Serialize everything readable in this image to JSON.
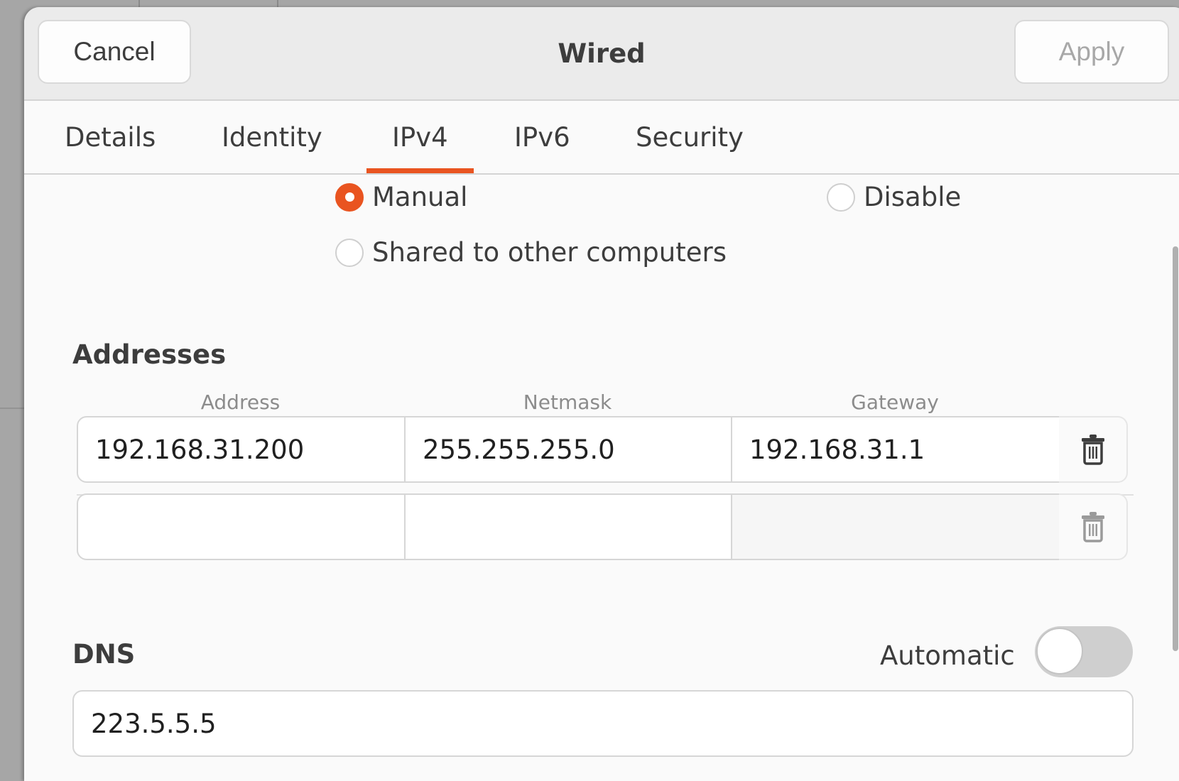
{
  "dialog": {
    "title": "Wired",
    "cancel_label": "Cancel",
    "apply_label": "Apply",
    "apply_enabled": false
  },
  "tabs": [
    {
      "label": "Details",
      "active": false
    },
    {
      "label": "Identity",
      "active": false
    },
    {
      "label": "IPv4",
      "active": true
    },
    {
      "label": "IPv6",
      "active": false
    },
    {
      "label": "Security",
      "active": false
    }
  ],
  "ipv4_method": {
    "options": [
      {
        "label": "Manual",
        "checked": true
      },
      {
        "label": "Disable",
        "checked": false
      },
      {
        "label": "Shared to other computers",
        "checked": false
      }
    ]
  },
  "addresses": {
    "title": "Addresses",
    "columns": [
      "Address",
      "Netmask",
      "Gateway"
    ],
    "rows": [
      {
        "address": "192.168.31.200",
        "netmask": "255.255.255.0",
        "gateway": "192.168.31.1",
        "delete_icon": "trash-icon"
      },
      {
        "address": "",
        "netmask": "",
        "gateway": "",
        "delete_icon": "trash-icon"
      }
    ]
  },
  "dns": {
    "title": "DNS",
    "automatic_label": "Automatic",
    "automatic_on": false,
    "value": "223.5.5.5"
  },
  "colors": {
    "accent": "#e95420",
    "header_bg": "#ebebeb",
    "content_bg": "#fafafa",
    "disabled_text": "#a8a8a8"
  }
}
